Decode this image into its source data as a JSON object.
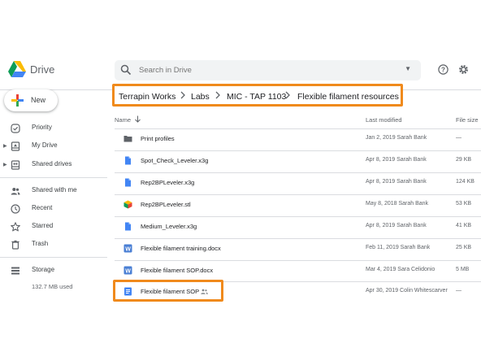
{
  "app": {
    "name": "Drive"
  },
  "search": {
    "placeholder": "Search in Drive"
  },
  "sidebar": {
    "new_label": "New",
    "items": [
      {
        "label": "Priority",
        "icon": "check-circle-icon"
      },
      {
        "label": "My Drive",
        "icon": "my-drive-icon",
        "expandable": true
      },
      {
        "label": "Shared drives",
        "icon": "shared-drives-icon",
        "expandable": true
      },
      {
        "label": "Shared with me",
        "icon": "people-icon"
      },
      {
        "label": "Recent",
        "icon": "clock-icon"
      },
      {
        "label": "Starred",
        "icon": "star-icon"
      },
      {
        "label": "Trash",
        "icon": "trash-icon"
      }
    ],
    "storage": {
      "label": "Storage",
      "used": "132.7 MB used"
    }
  },
  "breadcrumb": [
    "Terrapin Works",
    "Labs",
    "MIC - TAP 1103",
    "Flexible filament resources"
  ],
  "table": {
    "columns": {
      "name": "Name",
      "modified": "Last modified",
      "size": "File size"
    },
    "rows": [
      {
        "name": "Print profiles",
        "modified": "Jan 2, 2019 Sarah Bank",
        "size": "—",
        "icon": "folder-icon"
      },
      {
        "name": "Spot_Check_Leveler.x3g",
        "modified": "Apr 8, 2019 Sarah Bank",
        "size": "29 KB",
        "icon": "file-icon"
      },
      {
        "name": "Rep2BPLeveler.x3g",
        "modified": "Apr 8, 2019 Sarah Bank",
        "size": "124 KB",
        "icon": "file-icon"
      },
      {
        "name": "Rep2BPLeveler.stl",
        "modified": "May 8, 2018 Sarah Bank",
        "size": "53 KB",
        "icon": "3d-model-icon"
      },
      {
        "name": "Medium_Leveler.x3g",
        "modified": "Apr 8, 2019 Sarah Bank",
        "size": "41 KB",
        "icon": "file-icon"
      },
      {
        "name": "Flexible filament training.docx",
        "modified": "Feb 11, 2019 Sarah Bank",
        "size": "25 KB",
        "icon": "word-icon"
      },
      {
        "name": "Flexible filament SOP.docx",
        "modified": "Mar 4, 2019 Sara Celidonio",
        "size": "5 MB",
        "icon": "word-icon"
      },
      {
        "name": "Flexible filament SOP",
        "modified": "Apr 30, 2019 Colin Whitescarver",
        "size": "—",
        "icon": "google-doc-icon",
        "shared": true
      }
    ]
  },
  "colors": {
    "highlight": "#f08a1c",
    "folder": "#5f6368",
    "file_blue": "#4285f4",
    "word_blue": "#4a7fd4",
    "doc_blue": "#4285f4"
  }
}
